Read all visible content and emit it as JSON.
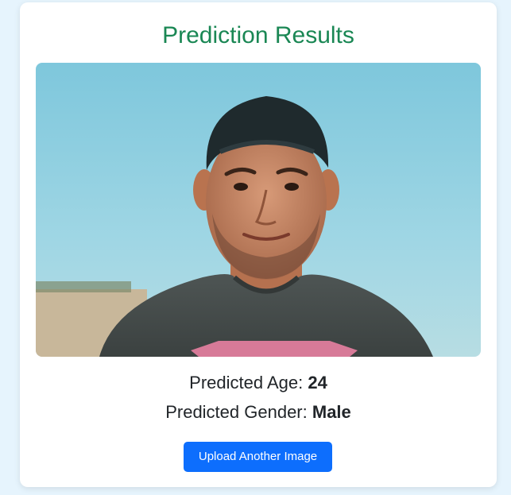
{
  "page": {
    "background_color": "#e6f4fd",
    "card_color": "#ffffff",
    "title": "Prediction Results",
    "title_color": "#1a8754"
  },
  "image": {
    "subject": "uploaded-face-photo"
  },
  "results": {
    "age_label": "Predicted Age:",
    "age_value": "24",
    "gender_label": "Predicted Gender:",
    "gender_value": "Male"
  },
  "actions": {
    "upload_label": "Upload Another Image",
    "button_color": "#0d6efd"
  }
}
